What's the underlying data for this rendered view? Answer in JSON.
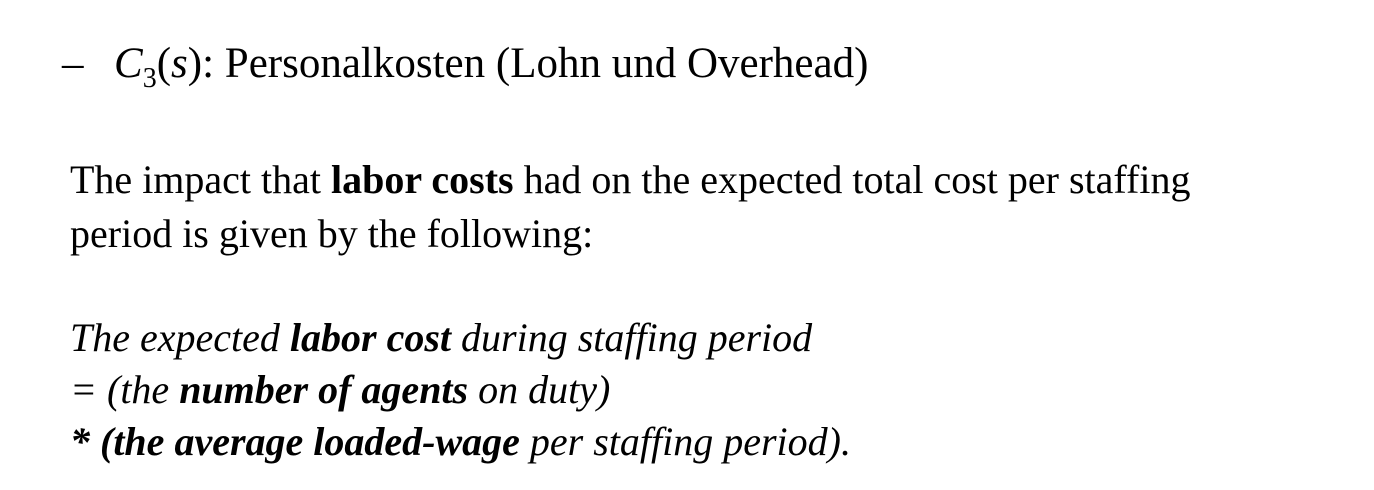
{
  "bullet": {
    "dash": "–",
    "var_letter": "C",
    "var_subscript": "3",
    "var_open": "(",
    "var_arg": "s",
    "var_close": ")",
    "label": ": Personalkosten (Lohn und Overhead)"
  },
  "paragraph": {
    "line1_before": "The impact that ",
    "line1_bold": "labor costs",
    "line1_after": " had on the expected total cost per staffing",
    "line2": "period is given by the following:"
  },
  "formula": {
    "line1_before": "The expected ",
    "line1_bold": "labor cost",
    "line1_after": " during staffing period",
    "line2_before": "= (the ",
    "line2_bold": "number of agents",
    "line2_after": " on duty)",
    "line3_star": "* (the ",
    "line3_bold": "average loaded-wage",
    "line3_after": " per staffing period)."
  }
}
